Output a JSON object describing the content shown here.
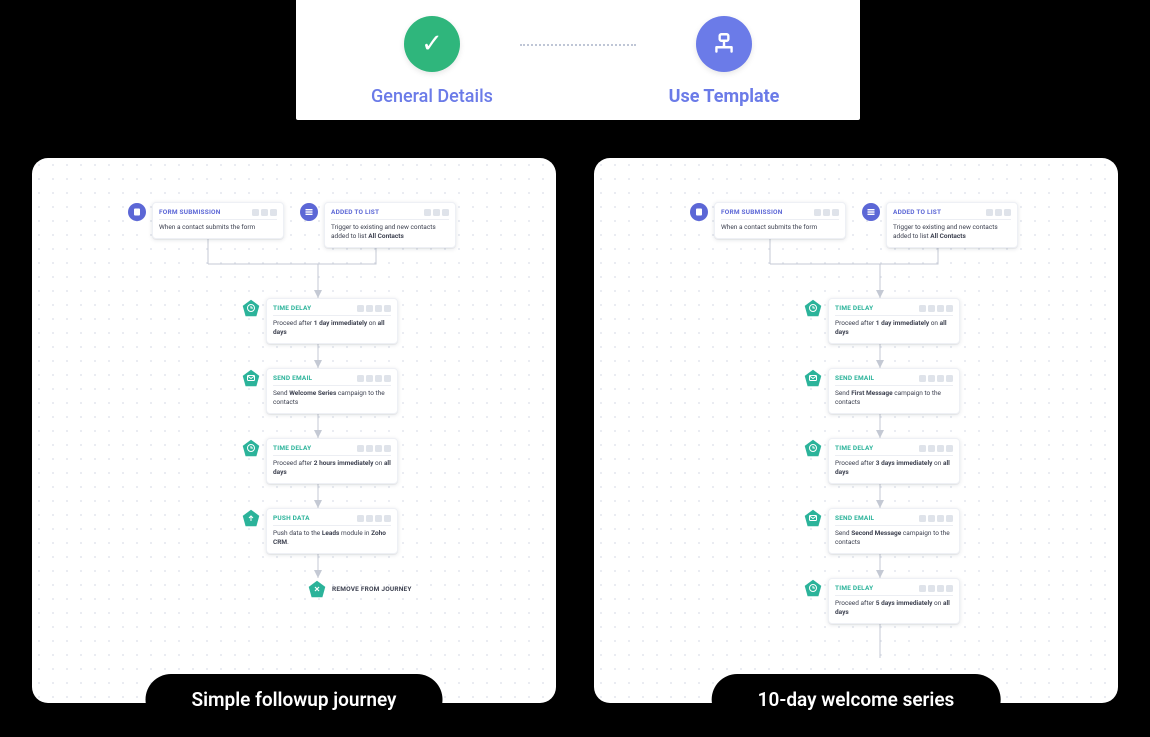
{
  "stepper": {
    "step1": "General Details",
    "step2": "Use Template"
  },
  "templates": [
    {
      "caption": "Simple followup  journey",
      "triggers": [
        {
          "title": "FORM SUBMISSION",
          "body_html": "When a contact submits the form"
        },
        {
          "title": "ADDED TO LIST",
          "body_html": "Trigger to existing and new contacts added to list <b>All Contacts</b>"
        }
      ],
      "steps": [
        {
          "title": "TIME DELAY",
          "body_html": "Proceed after <b>1 day immediately</b> on <b>all days</b>"
        },
        {
          "title": "SEND EMAIL",
          "body_html": "Send <b>Welcome Series</b> campaign to the contacts"
        },
        {
          "title": "TIME DELAY",
          "body_html": "Proceed after <b>2 hours immediately</b> on <b>all days</b>"
        },
        {
          "title": "PUSH DATA",
          "body_html": "Push data to the <b>Leads</b> module in <b>Zoho CRM</b>."
        }
      ],
      "end": "REMOVE FROM JOURNEY"
    },
    {
      "caption": "10-day welcome series",
      "triggers": [
        {
          "title": "FORM SUBMISSION",
          "body_html": "When a contact submits the form"
        },
        {
          "title": "ADDED TO LIST",
          "body_html": "Trigger to existing and new contacts added to list <b>All Contacts</b>"
        }
      ],
      "steps": [
        {
          "title": "TIME DELAY",
          "body_html": "Proceed after <b>1 day immediately</b> on <b>all days</b>"
        },
        {
          "title": "SEND EMAIL",
          "body_html": "Send <b>First Message</b> campaign to the contacts"
        },
        {
          "title": "TIME DELAY",
          "body_html": "Proceed after <b>3 days immediately</b> on <b>all days</b>"
        },
        {
          "title": "SEND EMAIL",
          "body_html": "Send <b>Second Message</b> campaign to the contacts"
        },
        {
          "title": "TIME DELAY",
          "body_html": "Proceed after <b>5 days immediately</b> on <b>all days</b>"
        }
      ]
    }
  ]
}
